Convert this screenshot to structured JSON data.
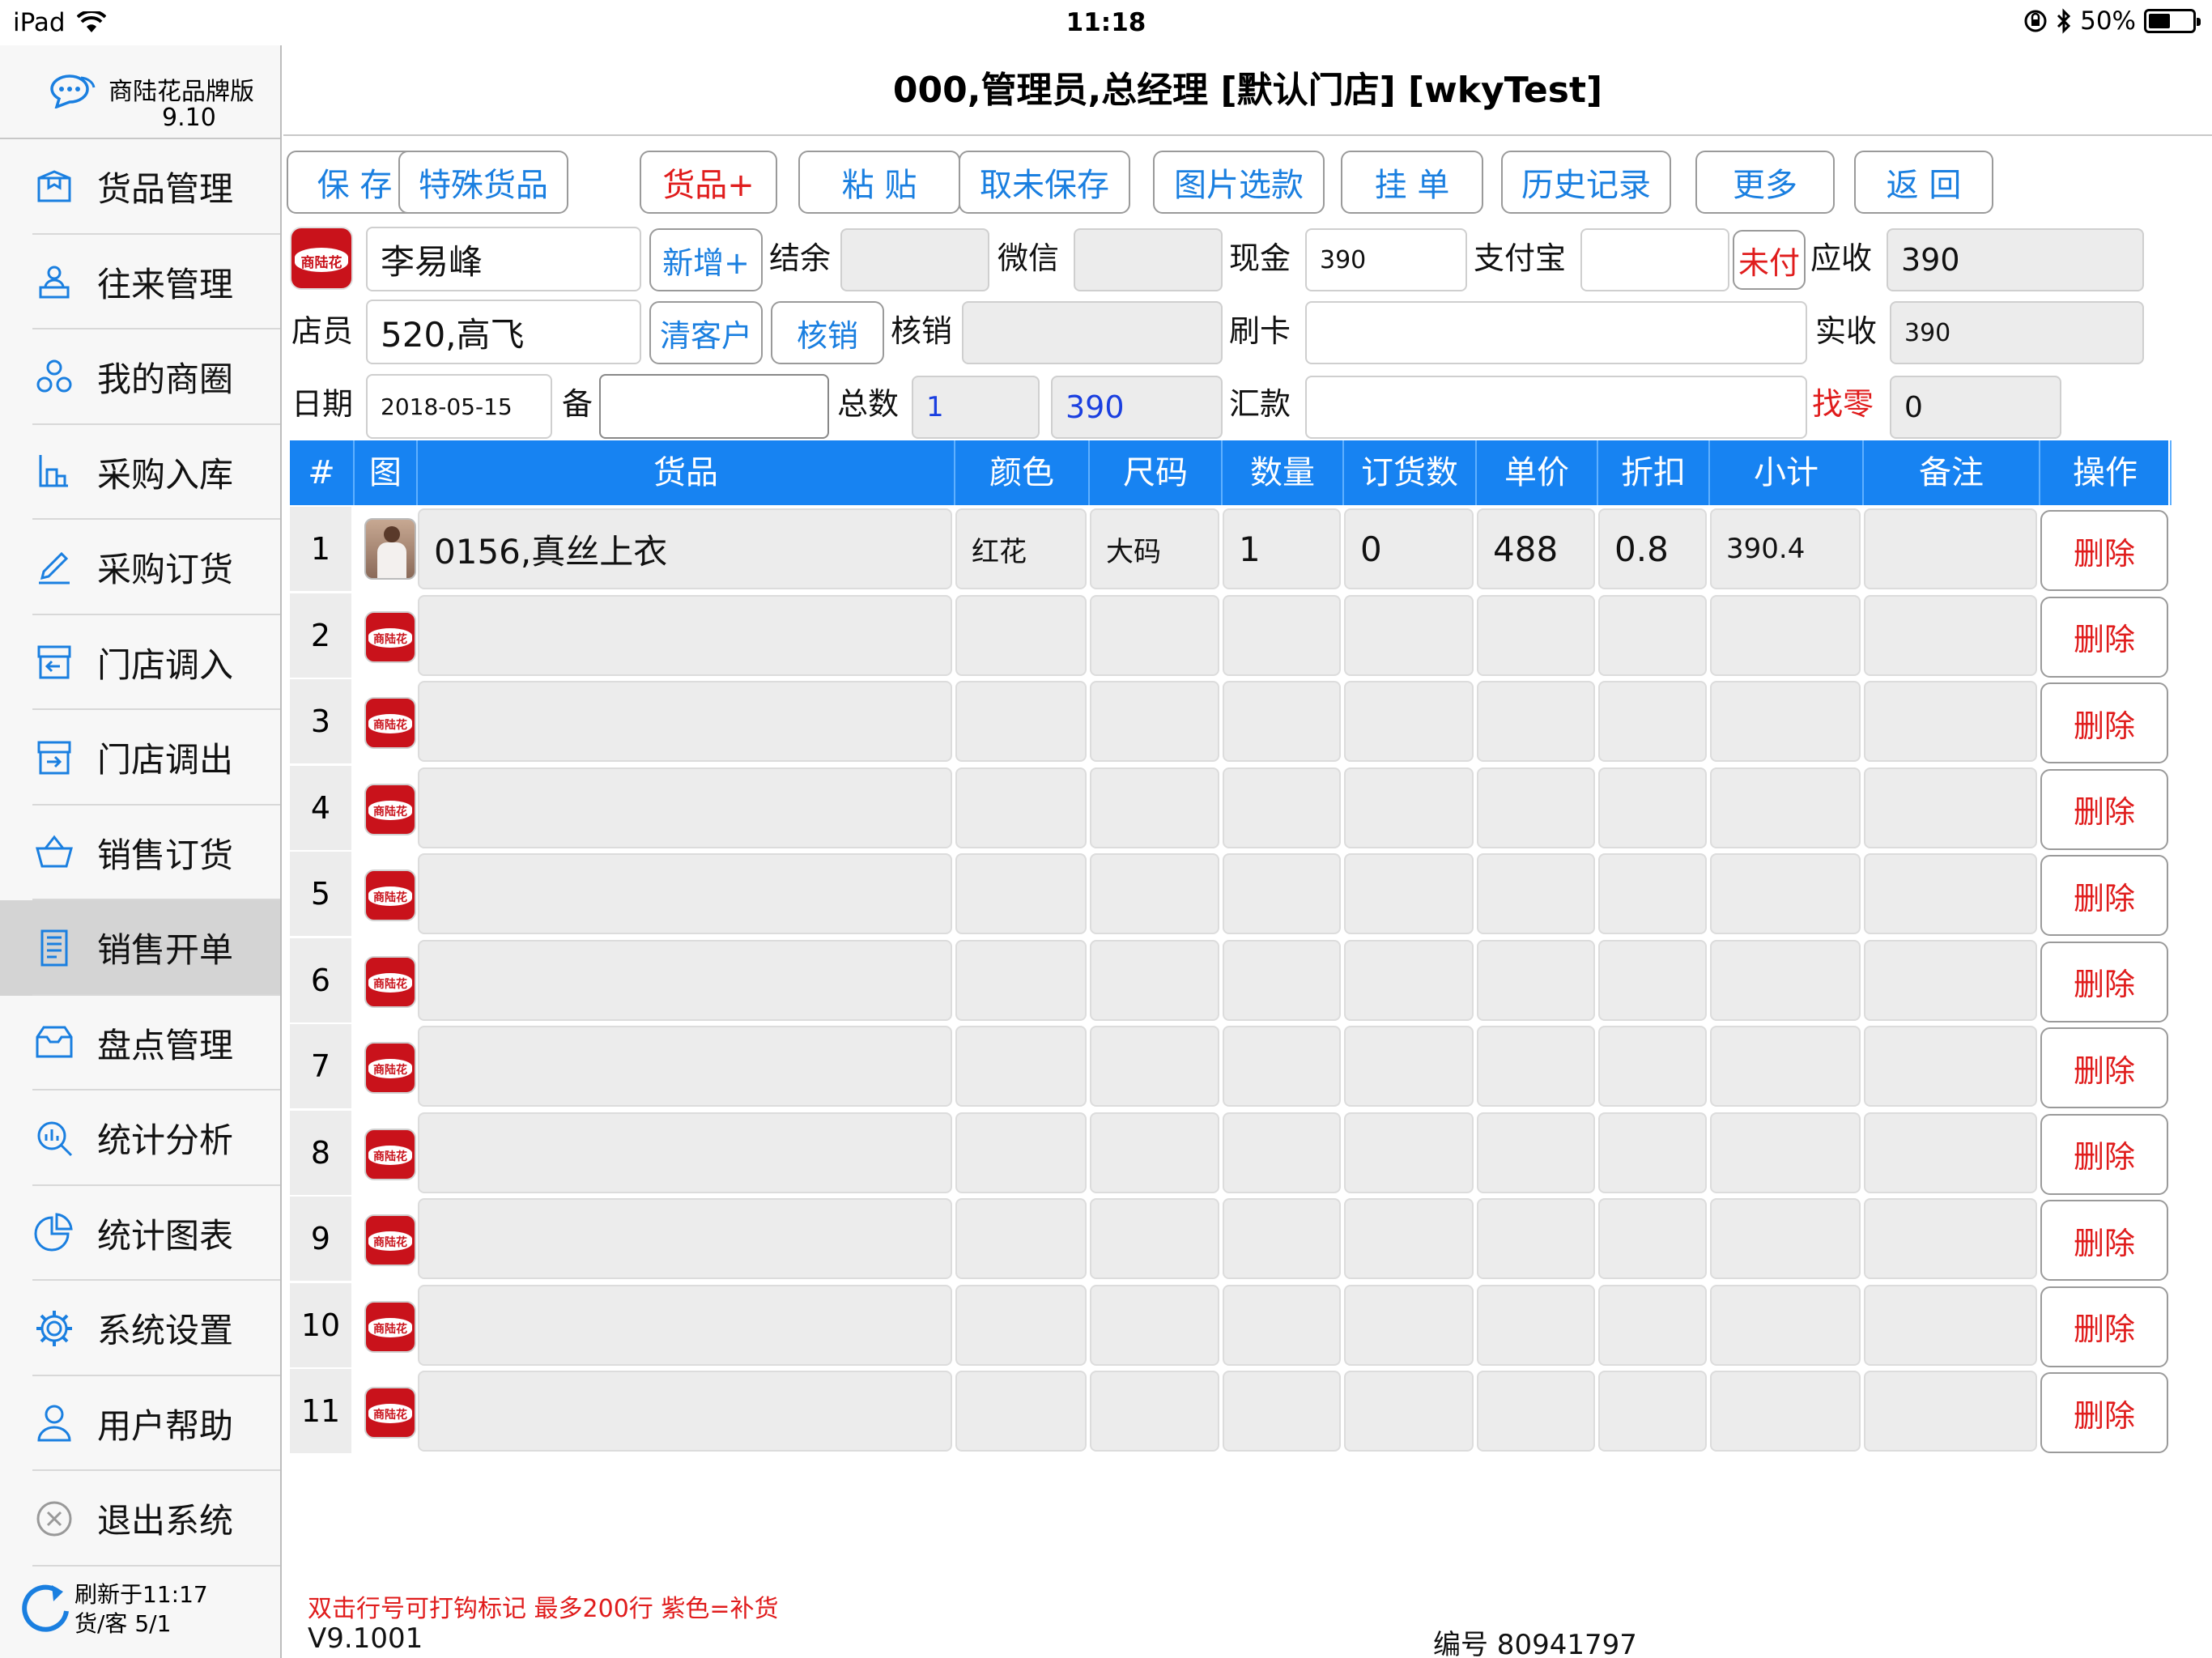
{
  "status": {
    "device": "iPad",
    "time": "11:18",
    "battery": "50%",
    "battery_level": 0.5
  },
  "brand": {
    "name": "商陆花品牌版",
    "version": "9.10"
  },
  "nav": [
    {
      "label": "货品管理",
      "icon": "box-icon"
    },
    {
      "label": "往来管理",
      "icon": "contacts-icon"
    },
    {
      "label": "我的商圈",
      "icon": "circle-icon"
    },
    {
      "label": "采购入库",
      "icon": "purchase-in-icon"
    },
    {
      "label": "采购订货",
      "icon": "pen-icon"
    },
    {
      "label": "门店调入",
      "icon": "store-in-icon"
    },
    {
      "label": "门店调出",
      "icon": "store-out-icon"
    },
    {
      "label": "销售订货",
      "icon": "basket-icon"
    },
    {
      "label": "销售开单",
      "icon": "document-icon",
      "active": true
    },
    {
      "label": "盘点管理",
      "icon": "inventory-icon"
    },
    {
      "label": "统计分析",
      "icon": "analysis-icon"
    },
    {
      "label": "统计图表",
      "icon": "pie-chart-icon"
    },
    {
      "label": "系统设置",
      "icon": "gear-icon"
    },
    {
      "label": "用户帮助",
      "icon": "user-icon"
    },
    {
      "label": "退出系统",
      "icon": "close-icon"
    }
  ],
  "refresh": {
    "line1": "刷新于11:17",
    "line2": "货/客  5/1"
  },
  "header": {
    "title": "000,管理员,总经理 [默认门店] [wkyTest]"
  },
  "toolbar": [
    "保 存",
    "特殊货品",
    "货品+",
    "粘 贴",
    "取未保存",
    "图片选款",
    "挂 单",
    "历史记录",
    "更多",
    "返 回"
  ],
  "form": {
    "customer": "李易峰",
    "add_btn": "新增+",
    "balance_label": "结余",
    "balance": "",
    "wechat_label": "微信",
    "wechat": "",
    "cash_label": "现金",
    "cash": "390",
    "alipay_label": "支付宝",
    "alipay": "",
    "unpaid_btn": "未付",
    "receivable_label": "应收",
    "receivable": "390",
    "clerk_label": "店员",
    "clerk": "520,高飞",
    "clear_btn": "清客户",
    "writeoff_btn": "核销",
    "writeoff_label": "核销",
    "writeoff": "",
    "card_label": "刷卡",
    "card": "",
    "received_label": "实收",
    "received": "390",
    "date_label": "日期",
    "date": "2018-05-15",
    "note_label": "备",
    "note": "",
    "total_label": "总数",
    "total_qty": "1",
    "total_amount": "390",
    "remit_label": "汇款",
    "remit": "",
    "change_label": "找零",
    "change": "0"
  },
  "table": {
    "headers": [
      "#",
      "图",
      "货品",
      "颜色",
      "尺码",
      "数量",
      "订货数",
      "单价",
      "折扣",
      "小计",
      "备注",
      "操作"
    ],
    "delete_label": "删除",
    "rows": [
      {
        "no": "1",
        "product": "0156,真丝上衣",
        "color": "红花",
        "size": "大码",
        "qty": "1",
        "order_qty": "0",
        "price": "488",
        "discount": "0.8",
        "subtotal": "390.4",
        "remark": "",
        "has_photo": true
      },
      {
        "no": "2"
      },
      {
        "no": "3"
      },
      {
        "no": "4"
      },
      {
        "no": "5"
      },
      {
        "no": "6"
      },
      {
        "no": "7"
      },
      {
        "no": "8"
      },
      {
        "no": "9"
      },
      {
        "no": "10"
      },
      {
        "no": "11"
      }
    ]
  },
  "badge_text": "商陆花",
  "footer": {
    "note": "双击行号可打钩标记 最多200行 紫色=补货",
    "version": "V9.1001",
    "serial": "编号 80941797"
  }
}
